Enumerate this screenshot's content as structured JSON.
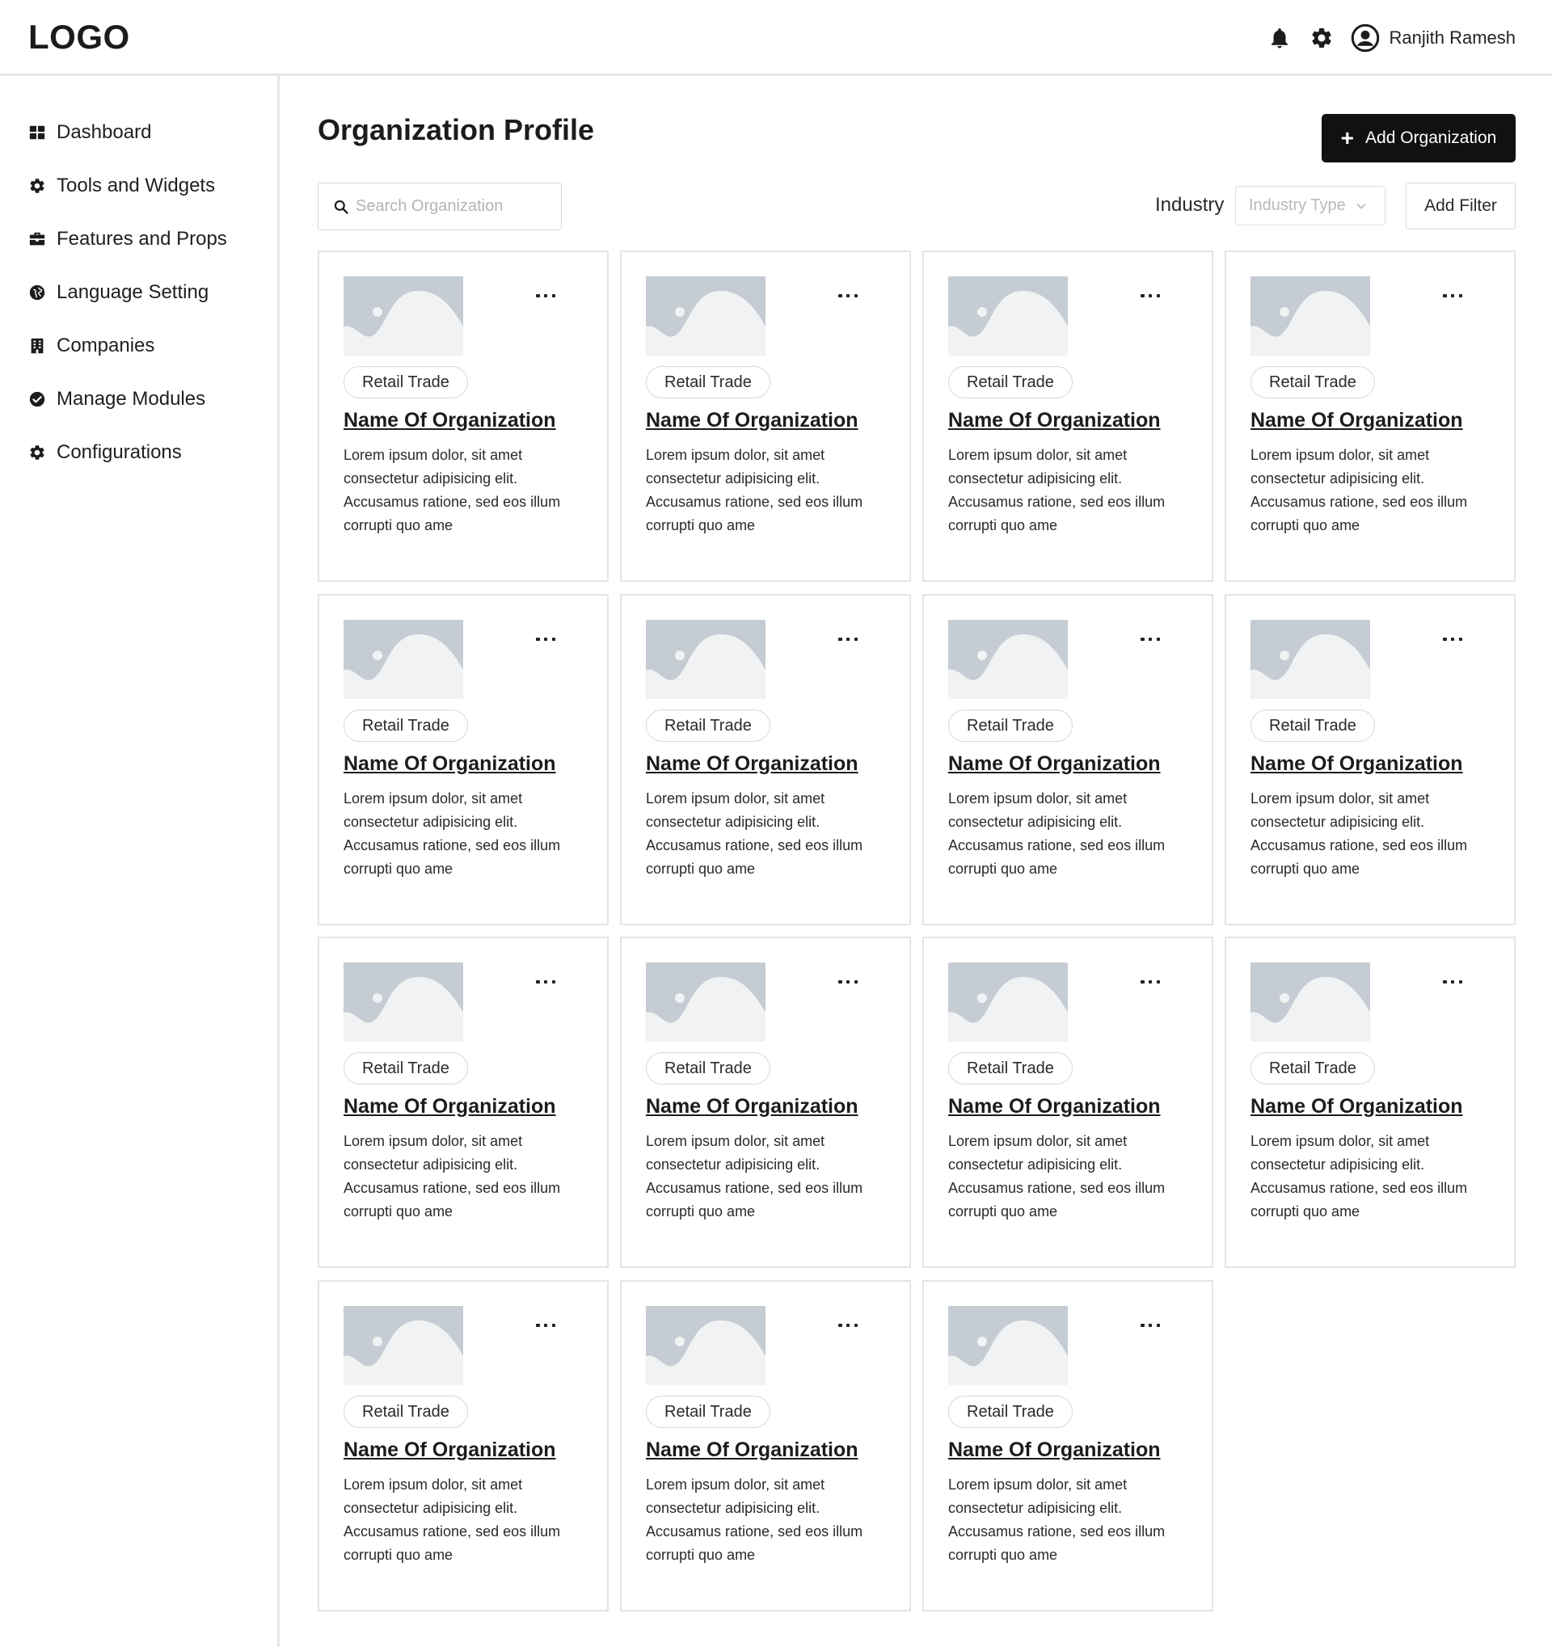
{
  "header": {
    "logo": "LOGO",
    "user_name": "Ranjith Ramesh"
  },
  "sidebar": {
    "items": [
      {
        "label": "Dashboard",
        "icon": "grid-icon"
      },
      {
        "label": "Tools and Widgets",
        "icon": "gear-icon"
      },
      {
        "label": "Features and Props",
        "icon": "briefcase-icon"
      },
      {
        "label": "Language Setting",
        "icon": "globe-icon"
      },
      {
        "label": "Companies",
        "icon": "building-icon"
      },
      {
        "label": "Manage Modules",
        "icon": "check-circle-icon"
      },
      {
        "label": "Configurations",
        "icon": "gear-icon"
      }
    ]
  },
  "main": {
    "title": "Organization Profile",
    "add_button_label": "Add Organization",
    "search_placeholder": "Search Organization",
    "industry_label": "Industry",
    "industry_select_value": "Industry Type",
    "add_filter_label": "Add Filter"
  },
  "cards": [
    {
      "tag": "Retail Trade",
      "name": "Name Of Organization",
      "desc": "Lorem ipsum dolor, sit amet consectetur adipisicing elit. Accusamus ratione, sed eos illum corrupti quo ame"
    },
    {
      "tag": "Retail Trade",
      "name": "Name Of Organization",
      "desc": "Lorem ipsum dolor, sit amet consectetur adipisicing elit. Accusamus ratione, sed eos illum corrupti quo ame"
    },
    {
      "tag": "Retail Trade",
      "name": "Name Of Organization",
      "desc": "Lorem ipsum dolor, sit amet consectetur adipisicing elit. Accusamus ratione, sed eos illum corrupti quo ame"
    },
    {
      "tag": "Retail Trade",
      "name": "Name Of Organization",
      "desc": "Lorem ipsum dolor, sit amet consectetur adipisicing elit. Accusamus ratione, sed eos illum corrupti quo ame"
    },
    {
      "tag": "Retail Trade",
      "name": "Name Of Organization",
      "desc": "Lorem ipsum dolor, sit amet consectetur adipisicing elit. Accusamus ratione, sed eos illum corrupti quo ame"
    },
    {
      "tag": "Retail Trade",
      "name": "Name Of Organization",
      "desc": "Lorem ipsum dolor, sit amet consectetur adipisicing elit. Accusamus ratione, sed eos illum corrupti quo ame"
    },
    {
      "tag": "Retail Trade",
      "name": "Name Of Organization",
      "desc": "Lorem ipsum dolor, sit amet consectetur adipisicing elit. Accusamus ratione, sed eos illum corrupti quo ame"
    },
    {
      "tag": "Retail Trade",
      "name": "Name Of Organization",
      "desc": "Lorem ipsum dolor, sit amet consectetur adipisicing elit. Accusamus ratione, sed eos illum corrupti quo ame"
    },
    {
      "tag": "Retail Trade",
      "name": "Name Of Organization",
      "desc": "Lorem ipsum dolor, sit amet consectetur adipisicing elit. Accusamus ratione, sed eos illum corrupti quo ame"
    },
    {
      "tag": "Retail Trade",
      "name": "Name Of Organization",
      "desc": "Lorem ipsum dolor, sit amet consectetur adipisicing elit. Accusamus ratione, sed eos illum corrupti quo ame"
    },
    {
      "tag": "Retail Trade",
      "name": "Name Of Organization",
      "desc": "Lorem ipsum dolor, sit amet consectetur adipisicing elit. Accusamus ratione, sed eos illum corrupti quo ame"
    },
    {
      "tag": "Retail Trade",
      "name": "Name Of Organization",
      "desc": "Lorem ipsum dolor, sit amet consectetur adipisicing elit. Accusamus ratione, sed eos illum corrupti quo ame"
    },
    {
      "tag": "Retail Trade",
      "name": "Name Of Organization",
      "desc": "Lorem ipsum dolor, sit amet consectetur adipisicing elit. Accusamus ratione, sed eos illum corrupti quo ame"
    },
    {
      "tag": "Retail Trade",
      "name": "Name Of Organization",
      "desc": "Lorem ipsum dolor, sit amet consectetur adipisicing elit. Accusamus ratione, sed eos illum corrupti quo ame"
    },
    {
      "tag": "Retail Trade",
      "name": "Name Of Organization",
      "desc": "Lorem ipsum dolor, sit amet consectetur adipisicing elit. Accusamus ratione, sed eos illum corrupti quo ame"
    }
  ],
  "colors": {
    "primary_button": "#111111",
    "border": "#e4e4e4",
    "placeholder_image": "#c5ccd3"
  }
}
